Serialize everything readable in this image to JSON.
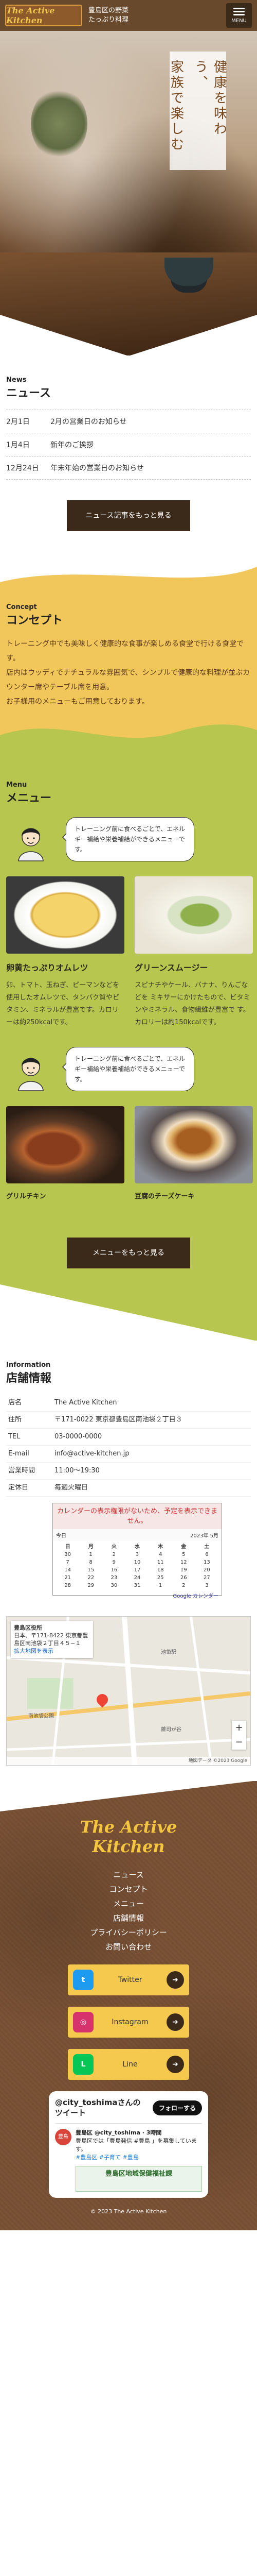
{
  "header": {
    "logo_text": "The Active Kitchen",
    "tagline_1": "豊島区の野菜",
    "tagline_2": "たっぷり料理",
    "menu_label": "MENU",
    "hero_lines": [
      "健康を味わう、",
      "家族で楽しむ"
    ]
  },
  "news": {
    "title_en": "News",
    "title_ja": "ニュース",
    "items": [
      {
        "date": "2月1日",
        "text": "2月の営業日のお知らせ"
      },
      {
        "date": "1月4日",
        "text": "新年のご挨拶"
      },
      {
        "date": "12月24日",
        "text": "年末年始の営業日のお知らせ"
      }
    ],
    "more_label": "ニュース記事をもっと見る"
  },
  "concept": {
    "title_en": "Concept",
    "title_ja": "コンセプト",
    "lines": [
      "トレーニング中でも美味しく健康的な食事が楽しめる食堂で行ける食堂です。",
      "店内はウッディでナチュラルな雰囲気で、シンプルで健康的な料理が並ぶカウンター席やテーブル席を用意。",
      "お子様用のメニューもご用意しております。"
    ]
  },
  "menu": {
    "title_en": "Menu",
    "title_ja": "メニュー",
    "bubble_1": "トレーニング前に食べるごとで、エネルギー補給や栄養補給ができるメニューです。",
    "bubble_2": "トレーニング前に食べるごとで、エネルギー補給や栄養補給ができるメニューです。",
    "items_1": [
      {
        "name": "卵黄たっぷりオムレツ",
        "desc": "卵、トマト、玉ねぎ、ピーマンなどを使用したオムレツで、タンパク質やビタミン、ミネラルが豊富です。カロリーは約250kcalです。"
      },
      {
        "name": "グリーンスムージー",
        "desc": "スピナチやケール、バナナ、りんごなどを ミキサーにかけたもので、ビタミンやミネラル、食物繊維が豊富で す。カロリーは約150kcalです。"
      }
    ],
    "items_2": [
      {
        "name": "グリルチキン"
      },
      {
        "name": "豆腐のチーズケーキ"
      }
    ],
    "more_label": "メニューをもっと見る"
  },
  "store": {
    "title_en": "Information",
    "title_ja": "店舗情報",
    "rows": [
      {
        "k": "店名",
        "v": "The Active Kitchen"
      },
      {
        "k": "住所",
        "v": "〒171-0022 東京都豊島区南池袋２丁目３"
      },
      {
        "k": "TEL",
        "v": "03-0000-0000"
      },
      {
        "k": "E-mail",
        "v": "info@active-kitchen.jp"
      },
      {
        "k": "営業時間",
        "v": "11:00〜19:30"
      },
      {
        "k": "定休日",
        "v": "毎週火曜日"
      }
    ],
    "calendar": {
      "note": "カレンダーの表示権限がないため、予定を表示できません。",
      "today": "今日",
      "month": "2023年 5月",
      "days": [
        "日",
        "月",
        "火",
        "水",
        "木",
        "金",
        "土"
      ],
      "dates": [
        "30",
        "1",
        "2",
        "3",
        "4",
        "5",
        "6",
        "7",
        "8",
        "9",
        "10",
        "11",
        "12",
        "13",
        "14",
        "15",
        "16",
        "17",
        "18",
        "19",
        "20",
        "21",
        "22",
        "23",
        "24",
        "25",
        "26",
        "27",
        "28",
        "29",
        "30",
        "31",
        "1",
        "2",
        "3"
      ],
      "foot": "Google カレンダー"
    },
    "map": {
      "place": "豊島区役所",
      "address": "日本、〒171-8422 東京都豊島区南池袋２丁目４５−１",
      "link": "拡大地図を表示",
      "labels": [
        "南池袋公園",
        "池袋駅",
        "雑司が谷"
      ],
      "footer": "地図データ ©2023 Google"
    }
  },
  "footer": {
    "logo_text": "The Active Kitchen",
    "nav": [
      "ニュース",
      "コンセプト",
      "メニュー",
      "店舗情報",
      "プライバシーポリシー",
      "お問い合わせ"
    ],
    "sns": [
      {
        "name": "Twitter",
        "icon": "twitter-icon",
        "color": "#1d9bf0",
        "glyph": "t"
      },
      {
        "name": "Instagram",
        "icon": "instagram-icon",
        "color": "#d6336c",
        "glyph": "◎"
      },
      {
        "name": "Line",
        "icon": "line-icon",
        "color": "#06c755",
        "glyph": "L"
      }
    ],
    "twitter": {
      "title": "@city_toshimaさんのツイート",
      "follow": "フォローする",
      "avatar": "豊島",
      "user": "豊島区 @city_toshima · 3時間",
      "text": "豊島区では「豊島発信 #豊島 」を募集しています。",
      "tags": "#豊島区 #子育て #豊島",
      "banner": "豊島区地域保健福祉課"
    },
    "copyright": "© 2023 The Active Kitchen"
  }
}
